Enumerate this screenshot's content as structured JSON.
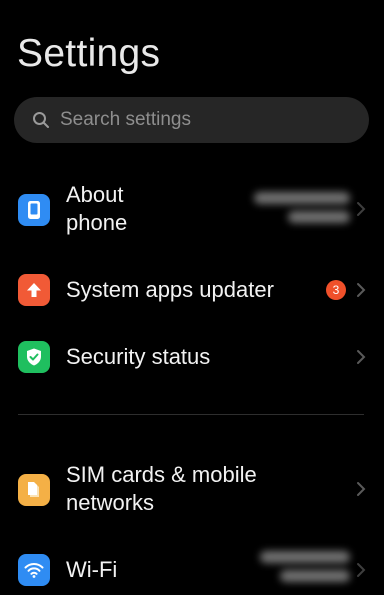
{
  "header": {
    "title": "Settings"
  },
  "search": {
    "placeholder": "Search settings"
  },
  "items": [
    {
      "label_line1": "About",
      "label_line2": "phone",
      "icon": "phone-icon",
      "color": "#2f8cf3"
    },
    {
      "label": "System apps updater",
      "badge": "3",
      "icon": "arrow-up-icon",
      "color": "#f15a36"
    },
    {
      "label": "Security status",
      "icon": "shield-check-icon",
      "color": "#1fbf5f"
    },
    {
      "label_line1": "SIM cards & mobile",
      "label_line2": "networks",
      "icon": "sim-card-icon",
      "color": "#f4b046"
    },
    {
      "label": "Wi-Fi",
      "icon": "wifi-icon",
      "color": "#2f8cf3"
    }
  ]
}
